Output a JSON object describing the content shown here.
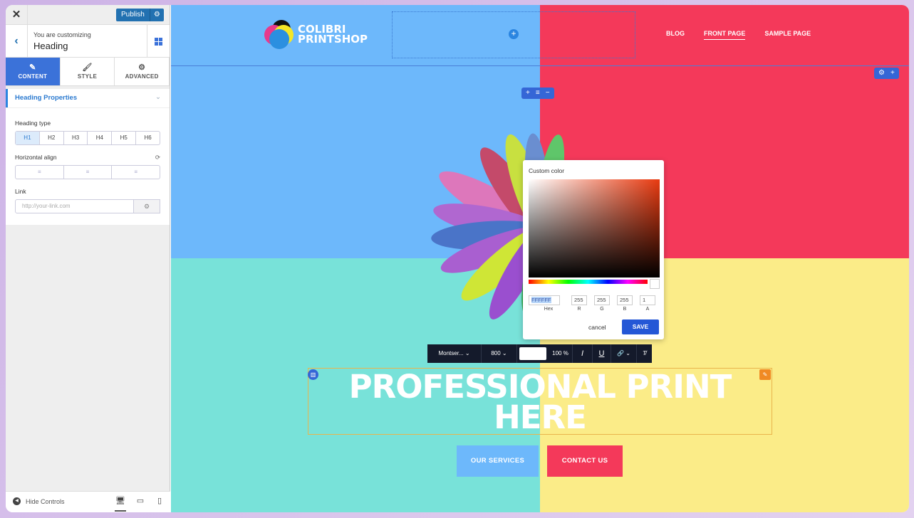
{
  "sidebar": {
    "close_icon": "close-icon",
    "publish_label": "Publish",
    "customizing_label": "You are customizing",
    "customizing_target": "Heading",
    "tabs": [
      {
        "label": "CONTENT",
        "icon": "pencil-icon"
      },
      {
        "label": "STYLE",
        "icon": "brush-icon"
      },
      {
        "label": "ADVANCED",
        "icon": "gears-icon"
      }
    ],
    "section_title": "Heading Properties",
    "heading_type_label": "Heading type",
    "heading_types": [
      "H1",
      "H2",
      "H3",
      "H4",
      "H5",
      "H6"
    ],
    "heading_type_selected": "H1",
    "horizontal_align_label": "Horizontal align",
    "link_label": "Link",
    "link_placeholder": "http://your-link.com",
    "hide_controls": "Hide Controls"
  },
  "site": {
    "logo_line1": "COLIBRI",
    "logo_line2": "PRINTSHOP",
    "menu": [
      "BLOG",
      "FRONT PAGE",
      "SAMPLE PAGE"
    ],
    "menu_active": "FRONT PAGE",
    "heading_line1": "PROFESSIONAL PRINT",
    "heading_line2": "HERE",
    "button_services": "OUR SERVICES",
    "button_contact": "CONTACT US",
    "colors": {
      "blue": "#6db8fb",
      "red": "#f4395a",
      "teal": "#78e2d9",
      "yellow": "#fbec88"
    }
  },
  "color_picker": {
    "title": "Custom color",
    "hex": "FFFFFF",
    "r": "255",
    "g": "255",
    "b": "255",
    "a": "1",
    "labels": {
      "hex": "Hex",
      "r": "R",
      "g": "G",
      "b": "B",
      "a": "A"
    },
    "cancel": "cancel",
    "save": "SAVE"
  },
  "text_toolbar": {
    "font": "Montser...",
    "weight": "800",
    "color": "#ffffff",
    "size": "100 %"
  }
}
